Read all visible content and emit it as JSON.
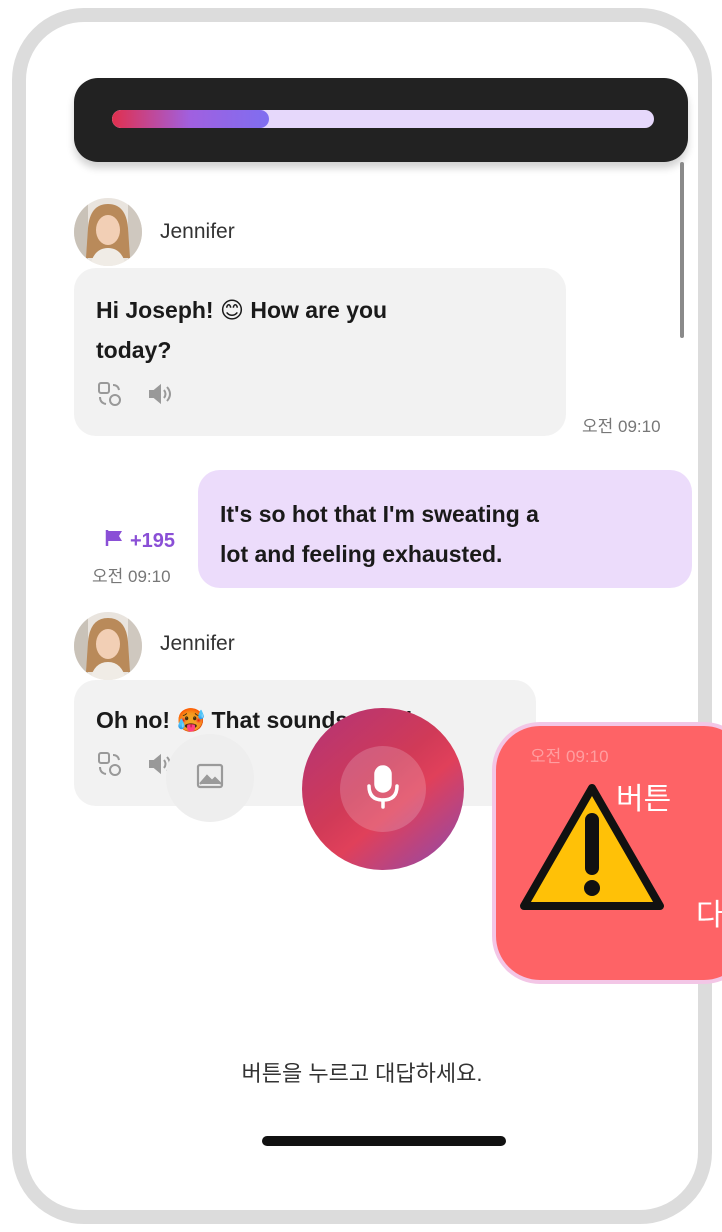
{
  "progress": {
    "fraction": 0.29
  },
  "messages": [
    {
      "sender": "Jennifer",
      "text": "Hi Joseph! 😊 How are you\ntoday?",
      "time": "오전 09:10"
    },
    {
      "text": "It's so hot that I'm sweating a\nlot and feeling exhausted.",
      "time": "오전 09:10",
      "points": "+195"
    },
    {
      "sender": "Jennifer",
      "text": "Oh no! 🥵 That sounds rough.",
      "time": "오전 09:10"
    }
  ],
  "icons": {
    "translate": "translate-icon",
    "speaker": "speaker-icon",
    "flag": "flag-icon",
    "image": "image-icon",
    "microphone": "microphone-icon",
    "keyboard": "keyboard-icon",
    "warning": "warning-icon"
  },
  "hint": "버튼을 누르고 대답하세요.",
  "alert": {
    "line1": "버튼",
    "line2": "다"
  },
  "colors": {
    "accent": "#8a4fd6",
    "alert_bg": "#fe6366",
    "outgoing_bubble": "#ecdcfb"
  }
}
